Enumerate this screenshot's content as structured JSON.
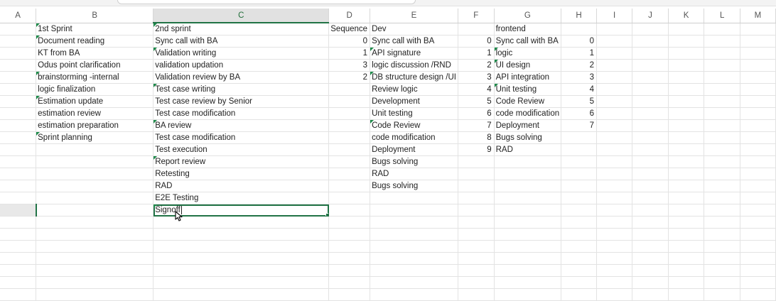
{
  "column_headers": [
    "A",
    "B",
    "C",
    "D",
    "E",
    "F",
    "G",
    "H",
    "I",
    "J",
    "K",
    "L",
    "M"
  ],
  "active_column": "C",
  "rows": [
    {
      "B": "1st Sprint",
      "C": "2nd sprint",
      "D": "Sequence",
      "E": "Dev",
      "F": "",
      "G": "frontend",
      "H": ""
    },
    {
      "B": "Document reading",
      "C": "Sync call with BA",
      "D": "0",
      "E": "Sync call with BA",
      "F": "0",
      "G": "Sync call with BA",
      "H": "0"
    },
    {
      "B": "KT from BA",
      "C": "Validation writing",
      "D": "1",
      "E": "API signature",
      "F": "1",
      "G": "logic",
      "H": "1"
    },
    {
      "B": "Odus point clarification",
      "C": "validation updation",
      "D": "3",
      "E": "logic discussion /RND",
      "F": "2",
      "G": "UI design",
      "H": "2"
    },
    {
      "B": "brainstorming -internal",
      "C": "Validation review by BA",
      "D": "2",
      "E": "DB structure design /UI",
      "F": "3",
      "G": "API integration",
      "H": "3"
    },
    {
      "B": "logic finalization",
      "C": "Test case writing",
      "D": "",
      "E": " Review logic",
      "F": "4",
      "G": "Unit testing",
      "H": "4"
    },
    {
      "B": "Estimation update",
      "C": "Test case review by Senior",
      "D": "",
      "E": "Development",
      "F": "5",
      "G": "Code Review",
      "H": "5"
    },
    {
      "B": "estimation review",
      "C": "Test case modification",
      "D": "",
      "E": "Unit testing",
      "F": "6",
      "G": "code modification",
      "H": "6"
    },
    {
      "B": "estimation preparation",
      "C": "BA review",
      "D": "",
      "E": "Code Review",
      "F": "7",
      "G": "Deployment",
      "H": "7"
    },
    {
      "B": "Sprint planning",
      "C": "Test case modification",
      "D": "",
      "E": "code modification",
      "F": "8",
      "G": "Bugs solving",
      "H": ""
    },
    {
      "B": "",
      "C": "Test execution",
      "D": "",
      "E": "Deployment",
      "F": "9",
      "G": "RAD",
      "H": ""
    },
    {
      "B": "",
      "C": "Report review",
      "D": "",
      "E": "Bugs solving",
      "F": "",
      "G": "",
      "H": ""
    },
    {
      "B": "",
      "C": "Retesting",
      "D": "",
      "E": "RAD",
      "F": "",
      "G": "",
      "H": ""
    },
    {
      "B": "",
      "C": "RAD",
      "D": "",
      "E": "Bugs solving",
      "F": "",
      "G": "",
      "H": ""
    },
    {
      "B": "",
      "C": "E2E Testing",
      "D": "",
      "E": "",
      "F": "",
      "G": "",
      "H": ""
    },
    {
      "B": "",
      "C": "Signoff",
      "D": "",
      "E": "",
      "F": "",
      "G": "",
      "H": ""
    },
    {
      "B": "",
      "C": "",
      "D": "",
      "E": "",
      "F": "",
      "G": "",
      "H": ""
    },
    {
      "B": "",
      "C": "",
      "D": "",
      "E": "",
      "F": "",
      "G": "",
      "H": ""
    },
    {
      "B": "",
      "C": "",
      "D": "",
      "E": "",
      "F": "",
      "G": "",
      "H": ""
    },
    {
      "B": "",
      "C": "",
      "D": "",
      "E": "",
      "F": "",
      "G": "",
      "H": ""
    },
    {
      "B": "",
      "C": "",
      "D": "",
      "E": "",
      "F": "",
      "G": "",
      "H": ""
    },
    {
      "B": "",
      "C": "",
      "D": "",
      "E": "",
      "F": "",
      "G": "",
      "H": ""
    },
    {
      "B": "",
      "C": "",
      "D": "",
      "E": "",
      "F": "",
      "G": "",
      "H": ""
    }
  ],
  "comment_markers": {
    "B": [
      0,
      1,
      4,
      6,
      9
    ],
    "C": [
      0,
      2,
      5,
      8,
      11,
      15
    ],
    "E": [
      2,
      4,
      8
    ],
    "G": [
      2,
      3,
      5
    ]
  },
  "active_cell": {
    "row": 15,
    "col": "C"
  },
  "editing_value": "Signoff",
  "colors": {
    "accent": "#217346",
    "grid": "#e3e3e3",
    "header_active": "#e1e1e1"
  },
  "icons": {
    "cursor": "text-select-cursor-icon"
  }
}
